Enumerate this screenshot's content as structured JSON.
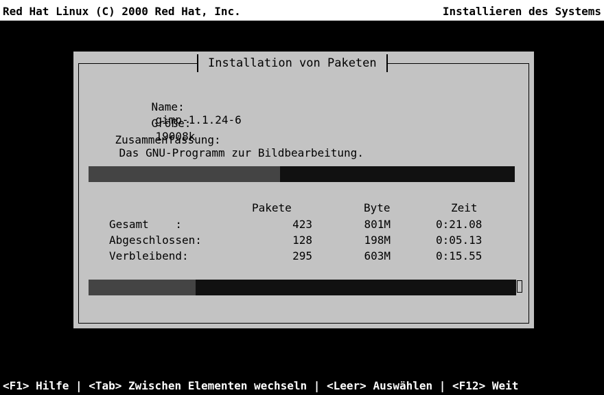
{
  "header": {
    "left": "Red Hat Linux (C) 2000 Red Hat, Inc.",
    "right": "Installieren des Systems"
  },
  "dialog": {
    "title": "Installation von Paketen",
    "package": {
      "name_label": "Name:",
      "name_value": "gimp-1.1.24-6",
      "size_label": "Größe:",
      "size_value": "19008k",
      "summary_label": "Zusammenfassung:",
      "summary_value": "Das GNU-Programm zur Bildbearbeitung."
    },
    "package_progress": 0.45,
    "stats": {
      "headers": {
        "packages": "Pakete",
        "bytes": "Byte",
        "time": "Zeit"
      },
      "rows": [
        {
          "label": "Gesamt    :",
          "packages": "423",
          "bytes": "801M",
          "time": "0:21.08"
        },
        {
          "label": "Abgeschlossen:",
          "packages": "128",
          "bytes": "198M",
          "time": "0:05.13"
        },
        {
          "label": "Verbleibend:",
          "packages": "295",
          "bytes": "603M",
          "time": "0:15.55"
        }
      ]
    },
    "total_progress": 0.25
  },
  "footer": {
    "help_text": "<F1> Hilfe | <Tab> Zwischen Elementen wechseln | <Leer> Auswählen | <F12> Weit"
  },
  "colors": {
    "background": "#000000",
    "dialog": "#c3c3c3",
    "bar_track": "#111111",
    "bar_fill": "#444444"
  }
}
